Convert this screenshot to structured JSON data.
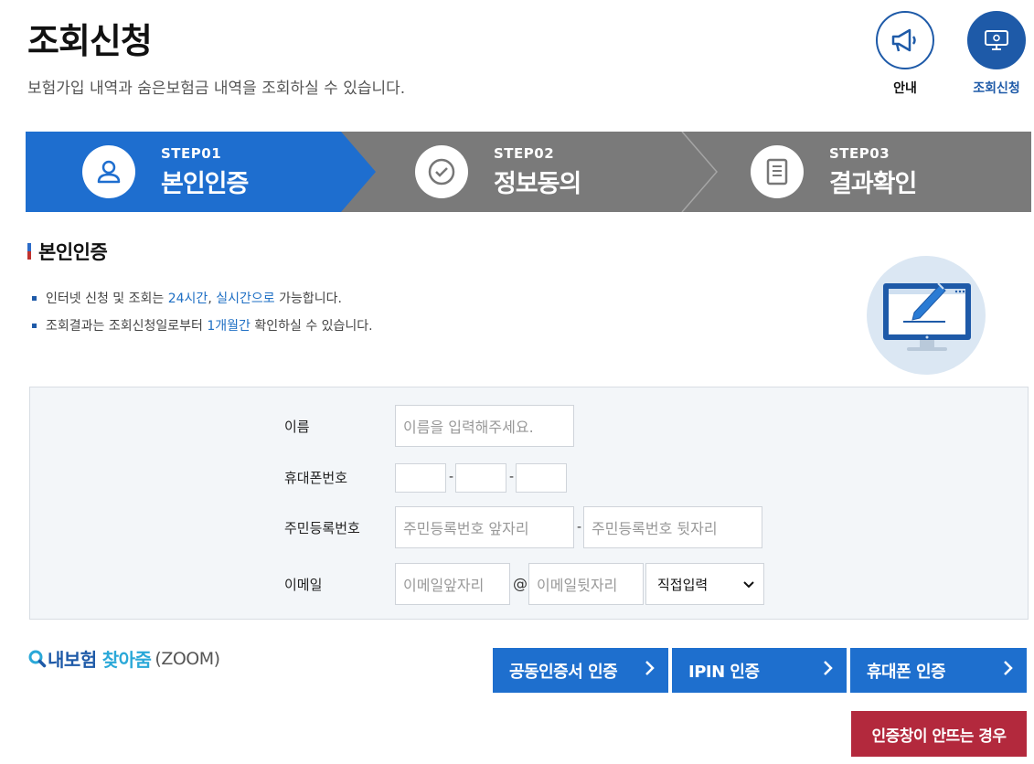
{
  "header": {
    "title": "조회신청",
    "description": "보험가입 내역과 숨은보험금 내역을 조회하실 수 있습니다."
  },
  "top_icons": [
    {
      "label": "안내",
      "icon": "megaphone-icon"
    },
    {
      "label": "조회신청",
      "icon": "monitor-gear-icon",
      "active": true
    }
  ],
  "steps": [
    {
      "num": "STEP01",
      "name": "본인인증",
      "icon": "user-icon",
      "active": true
    },
    {
      "num": "STEP02",
      "name": "정보동의",
      "icon": "check-circle-icon"
    },
    {
      "num": "STEP03",
      "name": "결과확인",
      "icon": "document-icon"
    }
  ],
  "section": {
    "title": "본인인증",
    "notes": [
      {
        "pre": "인터넷 신청 및 조회는 ",
        "hl1": "24시간",
        "mid": ", ",
        "hl2": "실시간으로",
        "post": " 가능합니다."
      },
      {
        "pre": "조회결과는 조회신청일로부터 ",
        "hl1": "1개월간",
        "post": " 확인하실 수 있습니다."
      }
    ]
  },
  "form": {
    "name_label": "이름",
    "name_placeholder": "이름을 입력해주세요.",
    "phone_label": "휴대폰번호",
    "phone_sep": "-",
    "rrn_label": "주민등록번호",
    "rrn_front_placeholder": "주민등록번호 앞자리",
    "rrn_back_placeholder": "주민등록번호 뒷자리",
    "rrn_sep": "-",
    "email_label": "이메일",
    "email_front_placeholder": "이메일앞자리",
    "email_at": "@",
    "email_back_placeholder": "이메일뒷자리",
    "email_domain_selected": "직접입력"
  },
  "zoom": {
    "part1": "내보험",
    "part2": "찾아줌",
    "part3": "(ZOOM)"
  },
  "buttons": {
    "cert": "공동인증서 인증",
    "ipin": "IPIN 인증",
    "phone": "휴대폰 인증",
    "fail": "인증창이 안뜨는 경우"
  },
  "colors": {
    "primary": "#1e6fce",
    "step_active": "#1e6ecf",
    "step_inactive": "#7a7a7a",
    "danger": "#b3293d"
  }
}
